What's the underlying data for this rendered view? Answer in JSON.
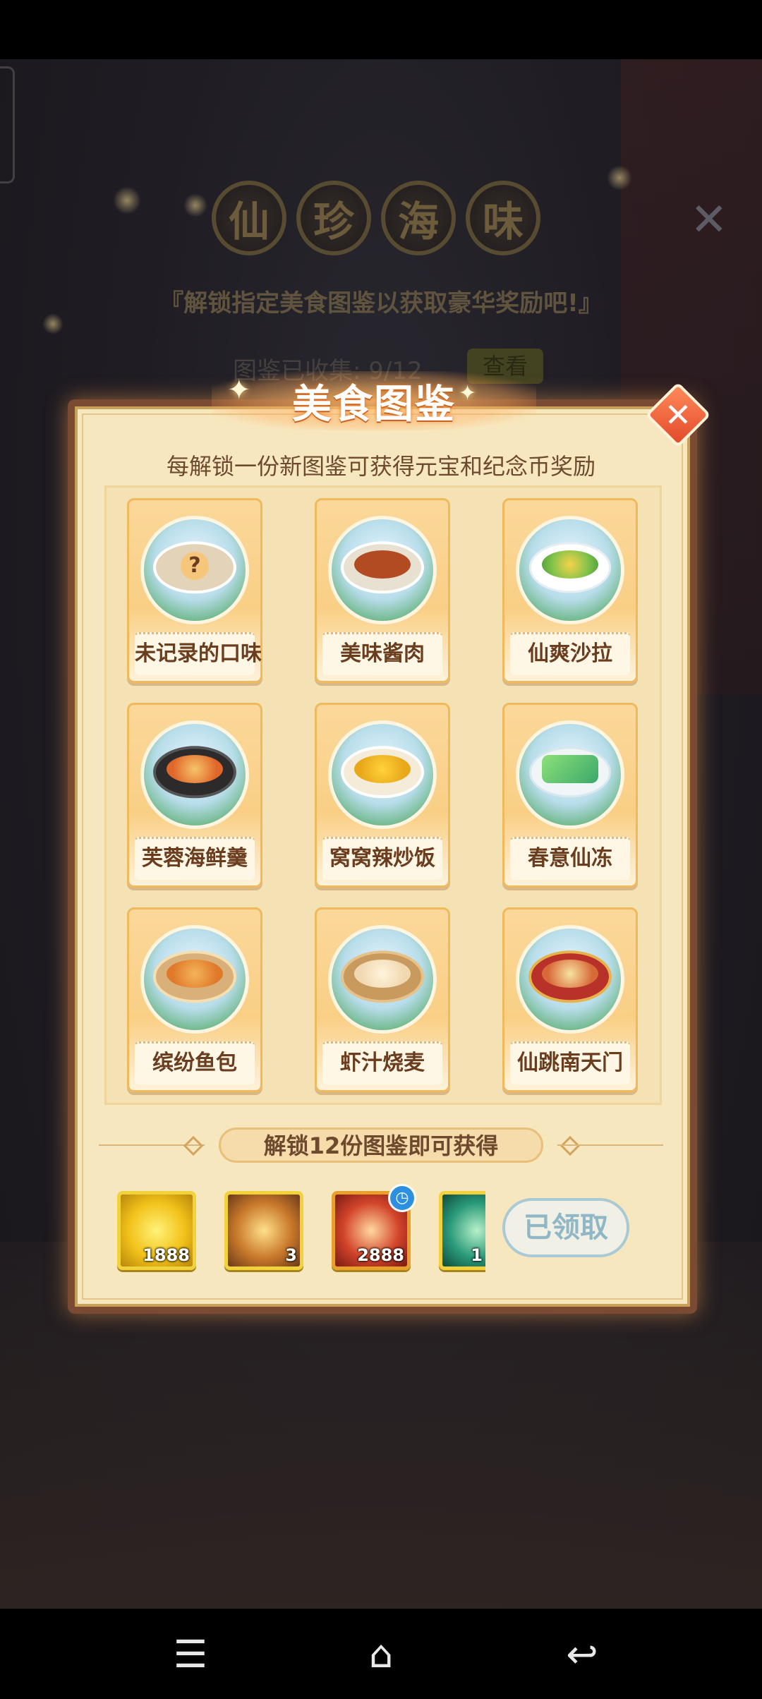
{
  "background": {
    "title_chars": [
      "仙",
      "珍",
      "海",
      "味"
    ],
    "subtitle": "『解锁指定美食图鉴以获取豪华奖励吧!』",
    "collected_text": "图鉴已收集: 9/12",
    "view_button": "查看",
    "close_icon": "close-icon"
  },
  "dialog": {
    "title": "美食图鉴",
    "hint": "每解锁一份新图鉴可获得元宝和纪念币奖励",
    "cards": [
      {
        "label": "未记录的口味",
        "locked": true
      },
      {
        "label": "美味酱肉"
      },
      {
        "label": "仙爽沙拉"
      },
      {
        "label": "芙蓉海鲜羹"
      },
      {
        "label": "窝窝辣炒饭"
      },
      {
        "label": "春意仙冻"
      },
      {
        "label": "缤纷鱼包"
      },
      {
        "label": "虾汁烧麦"
      },
      {
        "label": "仙跳南天门"
      }
    ],
    "unlock_banner": "解锁12份图鉴即可获得",
    "rewards": [
      {
        "name": "gold-ingots-icon",
        "count": "1888"
      },
      {
        "name": "treasure-chest-icon",
        "count": "3"
      },
      {
        "name": "points-token-icon",
        "count": "2888"
      },
      {
        "name": "commemorative-coin-icon",
        "count": "1"
      }
    ],
    "claimed_button": "已领取",
    "colors": {
      "accent": "#f0b95c",
      "frame": "#7a4a32",
      "panel": "#f7e7bf",
      "claimed": "#8fb7c6"
    }
  },
  "navbar": {
    "menu_icon": "☰",
    "home_icon": "⌂",
    "back_icon": "↩"
  }
}
